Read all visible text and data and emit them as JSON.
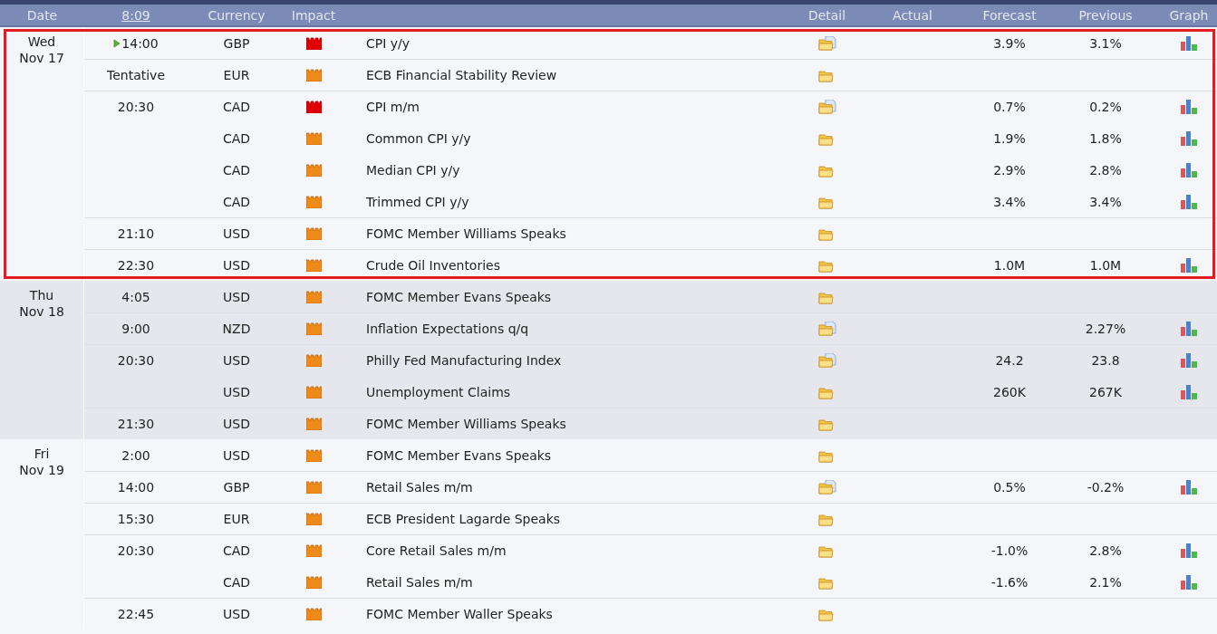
{
  "header": {
    "columns": [
      "Date",
      "8:09",
      "Currency",
      "Impact",
      "Detail",
      "Actual",
      "Forecast",
      "Previous",
      "Graph"
    ]
  },
  "days": [
    {
      "weekday": "Wed",
      "date": "Nov 17",
      "highlighted": true,
      "shaded": false,
      "events": [
        {
          "time": "14:00",
          "next": true,
          "currency": "GBP",
          "high_impact": true,
          "event": "CPI y/y",
          "has_document": true,
          "forecast": "3.9%",
          "previous": "3.1%",
          "graph": true
        },
        {
          "time": "Tentative",
          "next": false,
          "currency": "EUR",
          "high_impact": false,
          "event": "ECB Financial Stability Review",
          "has_document": false,
          "graph": false
        },
        {
          "time": "20:30",
          "next": false,
          "currency": "CAD",
          "high_impact": true,
          "event": "CPI m/m",
          "has_document": true,
          "forecast": "0.7%",
          "previous": "0.2%",
          "graph": true
        },
        {
          "next": false,
          "currency": "CAD",
          "high_impact": false,
          "event": "Common CPI y/y",
          "has_document": false,
          "forecast": "1.9%",
          "previous": "1.8%",
          "graph": true
        },
        {
          "next": false,
          "currency": "CAD",
          "high_impact": false,
          "event": "Median CPI y/y",
          "has_document": false,
          "forecast": "2.9%",
          "previous": "2.8%",
          "graph": true
        },
        {
          "next": false,
          "currency": "CAD",
          "high_impact": false,
          "event": "Trimmed CPI y/y",
          "has_document": false,
          "forecast": "3.4%",
          "previous": "3.4%",
          "graph": true
        },
        {
          "time": "21:10",
          "next": false,
          "currency": "USD",
          "high_impact": false,
          "event": "FOMC Member Williams Speaks",
          "has_document": false,
          "graph": false
        },
        {
          "time": "22:30",
          "next": false,
          "currency": "USD",
          "high_impact": false,
          "event": "Crude Oil Inventories",
          "has_document": false,
          "forecast": "1.0M",
          "previous": "1.0M",
          "graph": true
        }
      ]
    },
    {
      "weekday": "Thu",
      "date": "Nov 18",
      "highlighted": false,
      "shaded": true,
      "events": [
        {
          "time": "4:05",
          "next": false,
          "currency": "USD",
          "high_impact": false,
          "event": "FOMC Member Evans Speaks",
          "has_document": false,
          "graph": false
        },
        {
          "time": "9:00",
          "next": false,
          "currency": "NZD",
          "high_impact": false,
          "event": "Inflation Expectations q/q",
          "has_document": true,
          "previous": "2.27%",
          "graph": true
        },
        {
          "time": "20:30",
          "next": false,
          "currency": "USD",
          "high_impact": false,
          "event": "Philly Fed Manufacturing Index",
          "has_document": true,
          "forecast": "24.2",
          "previous": "23.8",
          "graph": true
        },
        {
          "next": false,
          "currency": "USD",
          "high_impact": false,
          "event": "Unemployment Claims",
          "has_document": false,
          "forecast": "260K",
          "previous": "267K",
          "graph": true
        },
        {
          "time": "21:30",
          "next": false,
          "currency": "USD",
          "high_impact": false,
          "event": "FOMC Member Williams Speaks",
          "has_document": false,
          "graph": false
        }
      ]
    },
    {
      "weekday": "Fri",
      "date": "Nov 19",
      "highlighted": false,
      "shaded": false,
      "events": [
        {
          "time": "2:00",
          "next": false,
          "currency": "USD",
          "high_impact": false,
          "event": "FOMC Member Evans Speaks",
          "has_document": false,
          "graph": false
        },
        {
          "time": "14:00",
          "next": false,
          "currency": "GBP",
          "high_impact": false,
          "event": "Retail Sales m/m",
          "has_document": true,
          "forecast": "0.5%",
          "previous": "-0.2%",
          "graph": true
        },
        {
          "time": "15:30",
          "next": false,
          "currency": "EUR",
          "high_impact": false,
          "event": "ECB President Lagarde Speaks",
          "has_document": false,
          "graph": false
        },
        {
          "time": "20:30",
          "next": false,
          "currency": "CAD",
          "high_impact": false,
          "event": "Core Retail Sales m/m",
          "has_document": false,
          "forecast": "-1.0%",
          "previous": "2.8%",
          "graph": true
        },
        {
          "next": false,
          "currency": "CAD",
          "high_impact": false,
          "event": "Retail Sales m/m",
          "has_document": false,
          "forecast": "-1.6%",
          "previous": "2.1%",
          "graph": true
        },
        {
          "time": "22:45",
          "next": false,
          "currency": "USD",
          "high_impact": false,
          "event": "FOMC Member Waller Speaks",
          "has_document": false,
          "graph": false
        }
      ]
    }
  ]
}
